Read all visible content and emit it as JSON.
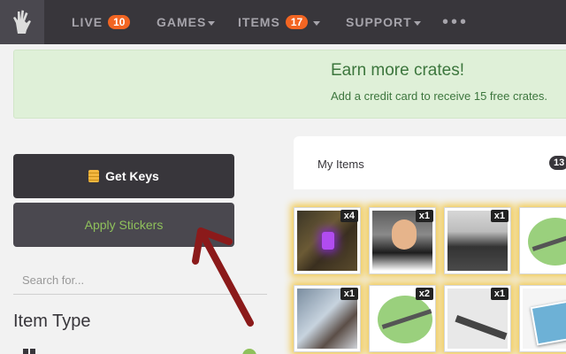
{
  "nav": {
    "logo_icon": "hand-logo-icon",
    "items": [
      {
        "label": "LIVE",
        "badge": "10"
      },
      {
        "label": "GAMES"
      },
      {
        "label": "ITEMS",
        "badge": "17"
      },
      {
        "label": "SUPPORT"
      }
    ],
    "more": "•••"
  },
  "banner": {
    "title": "Earn more crates!",
    "subtitle": "Add a credit card to receive 15 free crates."
  },
  "sidebar": {
    "get_keys": "Get Keys",
    "apply_stickers": "Apply Stickers",
    "search_placeholder": "Search for...",
    "item_type_heading": "Item Type"
  },
  "inventory": {
    "tab_label": "My Items",
    "count": "13",
    "tiles": [
      {
        "qty": "x4",
        "image": "crate"
      },
      {
        "qty": "x1",
        "image": "player-photo"
      },
      {
        "qty": "x1",
        "image": "team-photo"
      },
      {
        "qty": "",
        "image": "puzzle-sticker"
      },
      {
        "qty": "x1",
        "image": "artwork"
      },
      {
        "qty": "x2",
        "image": "puzzle-sticker"
      },
      {
        "qty": "x1",
        "image": "weapon-sticker"
      },
      {
        "qty": "",
        "image": "photo-card"
      }
    ]
  },
  "colors": {
    "nav_bg": "#38363b",
    "badge": "#f26522",
    "banner_bg": "#dff0d8",
    "banner_text": "#3c763d",
    "sticker_text": "#8fc15b",
    "glow": "#f3c94c",
    "arrow": "#8b1a1a"
  }
}
